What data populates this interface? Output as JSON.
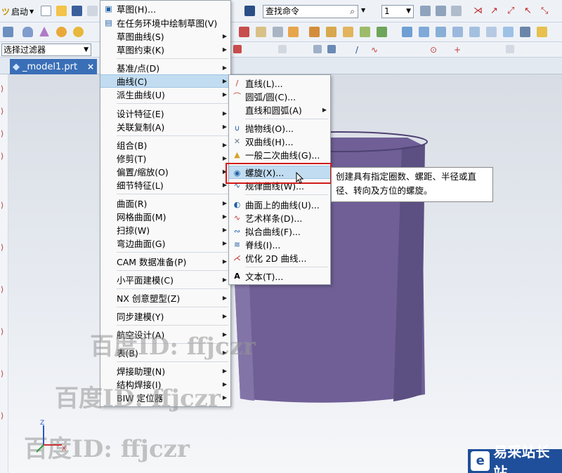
{
  "toolbar": {
    "start_label": "启动",
    "search_value": "查找命令",
    "number_value": "1",
    "filter_value": "选择过滤器"
  },
  "tab": {
    "file_name": "_model1.prt",
    "close": "×"
  },
  "main_menu": {
    "items": [
      {
        "label": "草图(H)...",
        "arrow": "",
        "icon": "sketch-icon"
      },
      {
        "label": "在任务环境中绘制草图(V)",
        "arrow": "",
        "icon": "sketch-task-icon"
      },
      {
        "label": "草图曲线(S)",
        "arrow": "▶"
      },
      {
        "label": "草图约束(K)",
        "arrow": "▶"
      },
      {
        "label": "基准/点(D)",
        "arrow": "▶"
      },
      {
        "label": "曲线(C)",
        "arrow": "▶"
      },
      {
        "label": "派生曲线(U)",
        "arrow": "▶"
      },
      {
        "label": "设计特征(E)",
        "arrow": "▶"
      },
      {
        "label": "关联复制(A)",
        "arrow": "▶"
      },
      {
        "label": "组合(B)",
        "arrow": "▶"
      },
      {
        "label": "修剪(T)",
        "arrow": "▶"
      },
      {
        "label": "偏置/缩放(O)",
        "arrow": "▶"
      },
      {
        "label": "细节特征(L)",
        "arrow": "▶"
      },
      {
        "label": "曲面(R)",
        "arrow": "▶"
      },
      {
        "label": "网格曲面(M)",
        "arrow": "▶"
      },
      {
        "label": "扫掠(W)",
        "arrow": "▶"
      },
      {
        "label": "弯边曲面(G)",
        "arrow": "▶"
      },
      {
        "label": "CAM 数据准备(P)",
        "arrow": "▶"
      },
      {
        "label": "小平面建模(C)",
        "arrow": "▶"
      },
      {
        "label": "NX 创意塑型(Z)",
        "arrow": "▶"
      },
      {
        "label": "同步建模(Y)",
        "arrow": "▶"
      },
      {
        "label": "航空设计(A)",
        "arrow": "▶"
      },
      {
        "label": "表(B)",
        "arrow": "▶"
      },
      {
        "label": "焊接助理(N)",
        "arrow": "▶"
      },
      {
        "label": "结构焊接(I)",
        "arrow": "▶"
      },
      {
        "label": "BIW 定位器",
        "arrow": "▶"
      }
    ]
  },
  "sub_menu": {
    "items": [
      {
        "label": "直线(L)...",
        "arrow": "",
        "icon": "line-icon",
        "glyph": "/"
      },
      {
        "label": "圆弧/圆(C)...",
        "arrow": "",
        "icon": "arc-icon",
        "glyph": "⌒"
      },
      {
        "label": "直线和圆弧(A)",
        "arrow": "▶",
        "icon": "",
        "glyph": ""
      },
      {
        "label": "抛物线(O)...",
        "arrow": "",
        "icon": "parabola-icon",
        "glyph": "∪"
      },
      {
        "label": "双曲线(H)...",
        "arrow": "",
        "icon": "hyperbola-icon",
        "glyph": "✕"
      },
      {
        "label": "一般二次曲线(G)...",
        "arrow": "",
        "icon": "conic-icon",
        "glyph": "▲"
      },
      {
        "label": "螺旋(X)...",
        "arrow": "",
        "icon": "helix-icon",
        "glyph": "◉"
      },
      {
        "label": "规律曲线(W)...",
        "arrow": "",
        "icon": "law-curve-icon",
        "glyph": "∿"
      },
      {
        "label": "曲面上的曲线(U)...",
        "arrow": "",
        "icon": "curve-on-surface-icon",
        "glyph": "◐"
      },
      {
        "label": "艺术样条(D)...",
        "arrow": "",
        "icon": "studio-spline-icon",
        "glyph": "∿"
      },
      {
        "label": "拟合曲线(F)...",
        "arrow": "",
        "icon": "fit-curve-icon",
        "glyph": "∾"
      },
      {
        "label": "脊线(I)...",
        "arrow": "",
        "icon": "spine-icon",
        "glyph": "≋"
      },
      {
        "label": "优化 2D 曲线...",
        "arrow": "",
        "icon": "optimize-2d-icon",
        "glyph": "⋌"
      },
      {
        "label": "文本(T)...",
        "arrow": "",
        "icon": "text-icon",
        "glyph": "A"
      }
    ]
  },
  "tooltip": {
    "line1": "创建具有指定圈数、螺距、半径或直",
    "line2": "径、转向及方位的螺旋。"
  },
  "watermark": {
    "text1": "百度ID: ffjczr",
    "text2": "百度ID: ffjczr",
    "text3": "百度ID: ffjczr"
  },
  "triad_labels": {
    "z": "Z",
    "x": "X"
  },
  "logo": {
    "text": "易采站长站",
    "glyph": "e"
  },
  "colors": {
    "highlight": "#c1dcf1",
    "frame": "#d21b1b",
    "solid": "#6f5f96",
    "tab": "#3a6fb7"
  }
}
